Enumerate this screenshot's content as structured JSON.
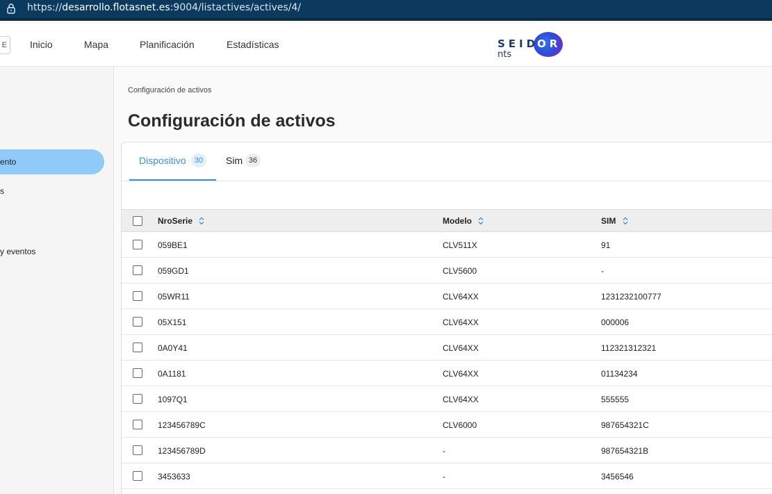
{
  "browser": {
    "url_prefix": "https://",
    "url_host": "desarrollo.flotasnet.es",
    "url_rest": ":9004/listactives/actives/4/"
  },
  "nav": {
    "menu_glyph": "E",
    "items": [
      "Inicio",
      "Mapa",
      "Planificación",
      "Estadísticas"
    ],
    "logo": {
      "brand": "SEIDOR",
      "brand_a": "SEID",
      "brand_b": "OR",
      "sub": "nts"
    }
  },
  "sidebar": {
    "items": [
      {
        "label": "ento",
        "active": true
      },
      {
        "label": "s",
        "active": false
      },
      {
        "label": "y eventos",
        "active": false
      }
    ]
  },
  "breadcrumb": "Configuración de activos",
  "page_title": "Configuración de activos",
  "tabs": [
    {
      "label": "Dispositivo",
      "count": "30",
      "active": true
    },
    {
      "label": "Sim",
      "count": "36",
      "active": false
    }
  ],
  "table": {
    "columns": [
      "NroSerie",
      "Modelo",
      "SIM"
    ],
    "rows": [
      [
        "059BE1",
        "CLV511X",
        "91"
      ],
      [
        "059GD1",
        "CLV5600",
        "-"
      ],
      [
        "05WR11",
        "CLV64XX",
        "1231232100777"
      ],
      [
        "05X151",
        "CLV64XX",
        "000006"
      ],
      [
        "0A0Y41",
        "CLV64XX",
        "112321312321"
      ],
      [
        "0A1181",
        "CLV64XX",
        "01134234"
      ],
      [
        "1097Q1",
        "CLV64XX",
        "555555"
      ],
      [
        "123456789C",
        "CLV6000",
        "987654321C"
      ],
      [
        "123456789D",
        "-",
        "987654321B"
      ],
      [
        "3453633",
        "-",
        "3456546"
      ]
    ]
  },
  "colors": {
    "accent": "#3b8fd9",
    "sidebar_active": "#90caf9",
    "browser_bar": "#0b3a5e"
  },
  "icons": [
    "lock-icon",
    "sort-icon",
    "checkbox-icon",
    "menu-icon"
  ]
}
